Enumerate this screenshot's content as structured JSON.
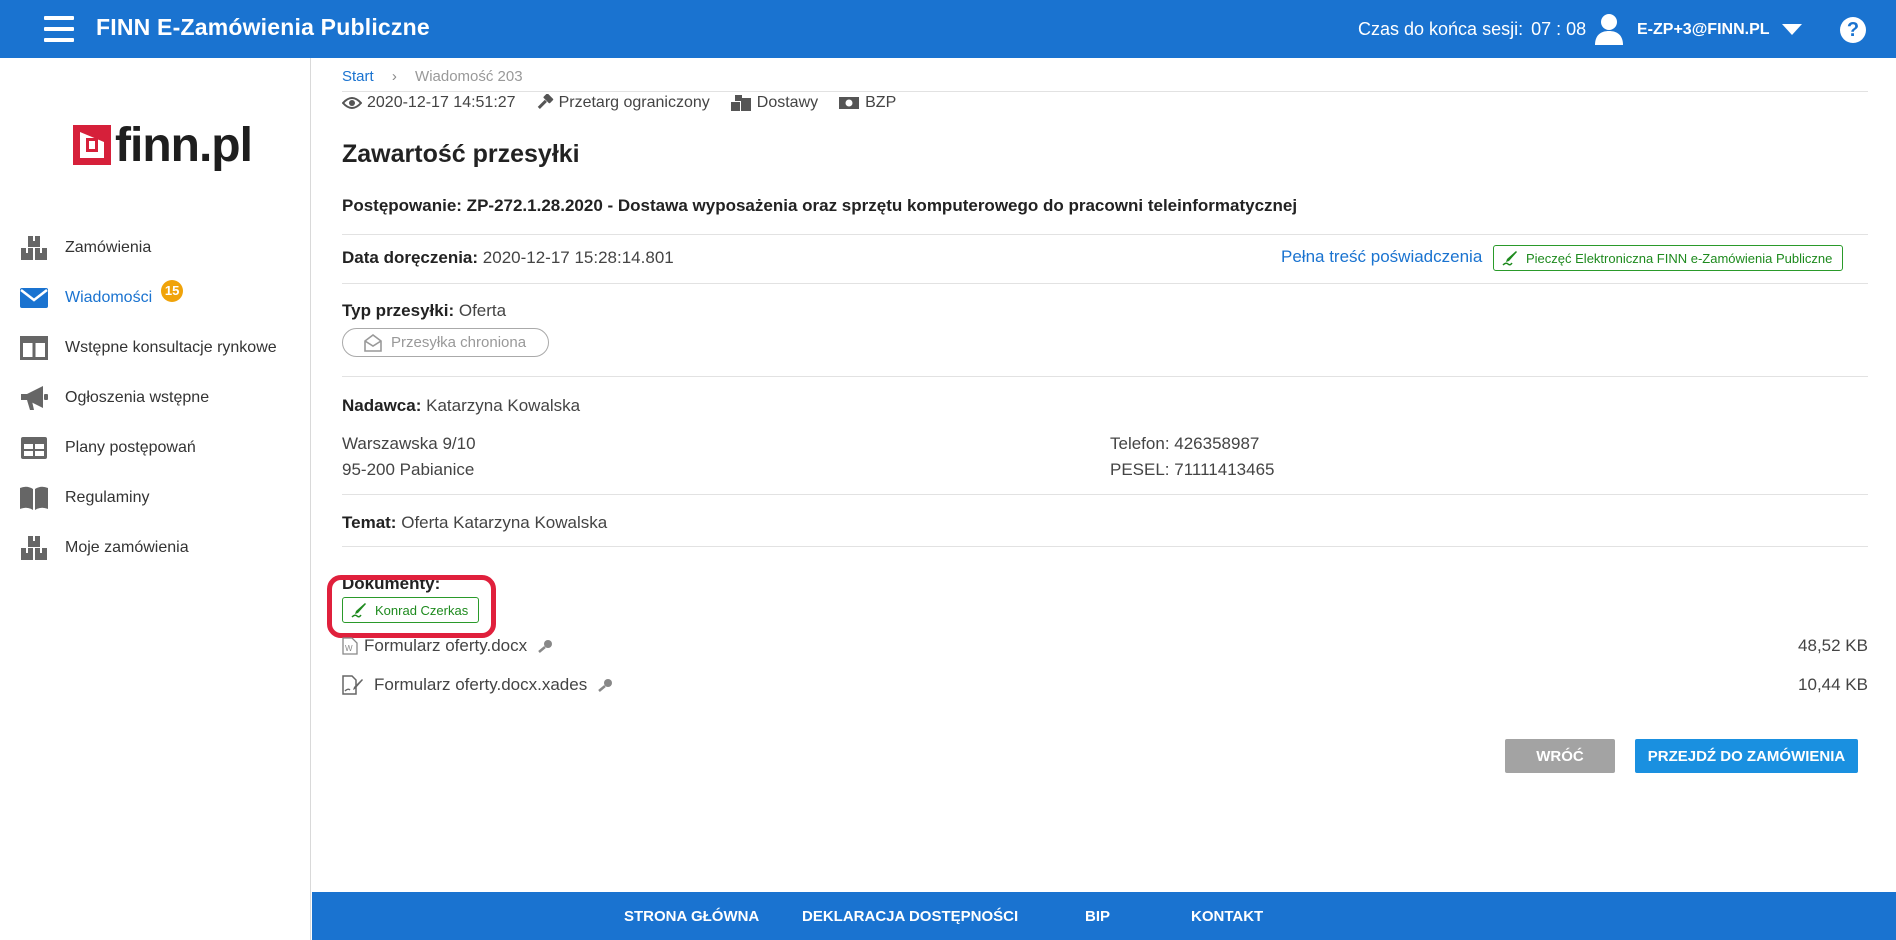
{
  "header": {
    "app_title": "FINN E-Zamówienia Publiczne",
    "session_label": "Czas do końca sesji:",
    "session_time": "07 : 08",
    "user_name": "E-ZP+3@FINN.PL",
    "help_icon": "?"
  },
  "sidebar": {
    "logo_text": "finn.pl",
    "items": [
      {
        "label": "Zamówienia",
        "icon": "boxes-icon"
      },
      {
        "label": "Wiadomości",
        "icon": "envelope-icon",
        "badge": "15",
        "active": true
      },
      {
        "label": "Wstępne konsultacje rynkowe",
        "icon": "columns-icon"
      },
      {
        "label": "Ogłoszenia wstępne",
        "icon": "megaphone-icon"
      },
      {
        "label": "Plany postępowań",
        "icon": "table-icon"
      },
      {
        "label": "Regulaminy",
        "icon": "book-icon"
      },
      {
        "label": "Moje zamówienia",
        "icon": "boxes-icon"
      }
    ]
  },
  "breadcrumb": {
    "start": "Start",
    "current": "Wiadomość 203"
  },
  "meta": {
    "date": "2020-12-17 14:51:27",
    "mode": "Przetarg ograniczony",
    "type": "Dostawy",
    "bzp": "BZP"
  },
  "page_title": "Zawartość przesyłki",
  "proceeding": "Postępowanie: ZP-272.1.28.2020 - Dostawa wyposażenia oraz sprzętu komputerowego do pracowni teleinformatycznej",
  "delivery": {
    "label": "Data doręczenia:",
    "value": "2020-12-17 15:28:14.801",
    "full_link": "Pełna treść poświadczenia",
    "seal": "Pieczęć Elektroniczna FINN e-Zamówienia Publiczne"
  },
  "shipment": {
    "label": "Typ przesyłki:",
    "value": "Oferta",
    "chip": "Przesyłka chroniona"
  },
  "sender": {
    "label": "Nadawca:",
    "name": "Katarzyna Kowalska",
    "street": "Warszawska 9/10",
    "city": "95-200 Pabianice",
    "phone": "Telefon: 426358987",
    "pesel": "PESEL: 71111413465"
  },
  "subject": {
    "label": "Temat:",
    "value": "Oferta Katarzyna Kowalska"
  },
  "documents": {
    "label": "Dokumenty:",
    "signer": "Konrad Czerkas",
    "files": [
      {
        "name": "Formularz oferty.docx",
        "size": "48,52 KB",
        "icon": "word-file-icon"
      },
      {
        "name": "Formularz oferty.docx.xades",
        "size": "10,44 KB",
        "icon": "signed-file-icon"
      }
    ]
  },
  "buttons": {
    "back": "WRÓĆ",
    "go": "PRZEJDŹ DO ZAMÓWIENIA"
  },
  "footer": {
    "links": [
      "STRONA GŁÓWNA",
      "DEKLARACJA DOSTĘPNOŚCI",
      "BIP",
      "KONTAKT"
    ]
  },
  "colors": {
    "brand_blue": "#1a73d0",
    "seal_green": "#1e8a1e",
    "badge_orange": "#f0a30a",
    "highlight_red": "#e0203c"
  }
}
